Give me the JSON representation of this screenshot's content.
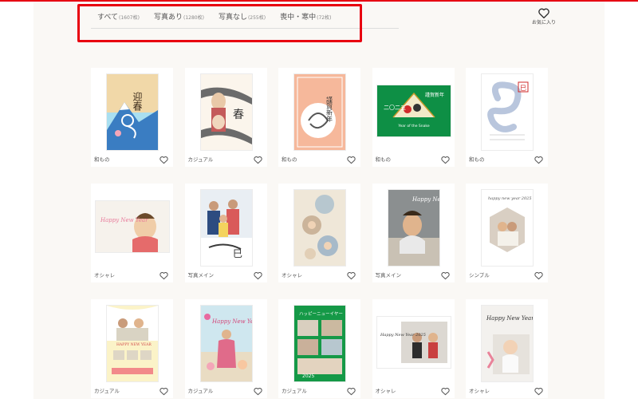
{
  "tabs": [
    {
      "label": "すべて",
      "count": "(1607枚)"
    },
    {
      "label": "写真あり",
      "count": "(1280枚)"
    },
    {
      "label": "写真なし",
      "count": "(255枚)"
    },
    {
      "label": "喪中・寒中",
      "count": "(72枚)"
    }
  ],
  "favorites": {
    "label": "お気に入り",
    "icon": "heart-icon"
  },
  "cards": [
    {
      "category": "和もの",
      "art": "fuji-snake",
      "title_text": "迎春"
    },
    {
      "category": "カジュアル",
      "art": "photo-snake",
      "title_text": "春"
    },
    {
      "category": "和もの",
      "art": "peach-snake",
      "title_text": "謹賀新年"
    },
    {
      "category": "和もの",
      "art": "green-fan",
      "title_text": "謹賀新年",
      "subtitle_text": "Year of the Snake",
      "year_text": "二〇二五"
    },
    {
      "category": "和もの",
      "art": "blue-snake",
      "title_text": "巳"
    },
    {
      "category": "オシャレ",
      "art": "child-happy",
      "title_text": "Happy New Year"
    },
    {
      "category": "写真メイン",
      "art": "family-photo",
      "title_text": "巳"
    },
    {
      "category": "オシャレ",
      "art": "circle-photos",
      "title_text": ""
    },
    {
      "category": "写真メイン",
      "art": "boy-eating",
      "title_text": "Happy New Year"
    },
    {
      "category": "シンプル",
      "art": "family-circle",
      "title_text": "happy new year 2025"
    },
    {
      "category": "カジュアル",
      "art": "yellow-family",
      "title_text": "HAPPY NEW YEAR"
    },
    {
      "category": "カジュアル",
      "art": "flower-girl",
      "title_text": "Happy New Year"
    },
    {
      "category": "カジュアル",
      "art": "green-collage",
      "title_text": "ハッピーニューイヤー",
      "year_text": "2025"
    },
    {
      "category": "オシャレ",
      "art": "collage-happy",
      "title_text": "Happy New Year 2025"
    },
    {
      "category": "オシャレ",
      "art": "baby-happy",
      "title_text": "Happy New Year"
    }
  ]
}
